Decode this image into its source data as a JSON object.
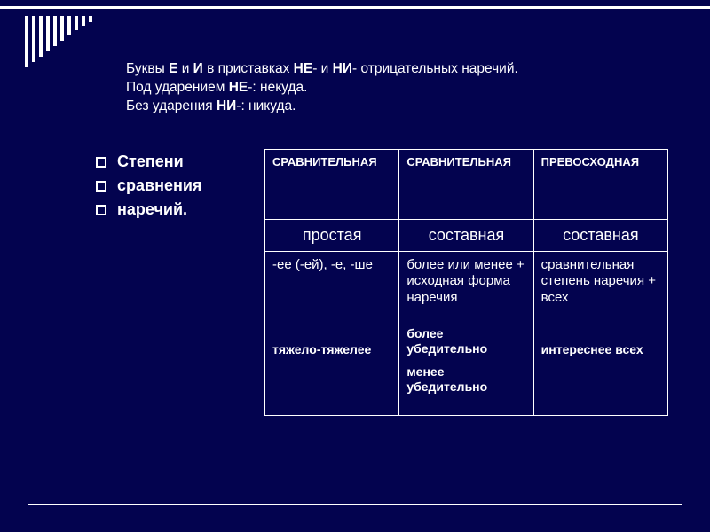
{
  "title": {
    "line1_a": "Буквы ",
    "line1_b": "Е",
    "line1_c": " и ",
    "line1_d": "И",
    "line1_e": " в приставках ",
    "line1_f": "НЕ",
    "line1_g": "- и ",
    "line1_h": "НИ",
    "line1_i": "- отрицательных наречий.",
    "line2_a": "Под ударением ",
    "line2_b": "НЕ",
    "line2_c": "-: некуда.",
    "line3_a": "Без ударения ",
    "line3_b": "НИ",
    "line3_c": "-: никуда."
  },
  "left_list": {
    "i0": "Степени",
    "i1": "сравнения",
    "i2": "наречий."
  },
  "table": {
    "head": {
      "c0": "СРАВНИТЕЛЬНАЯ",
      "c1": "СРАВНИТЕЛЬНАЯ",
      "c2": "ПРЕВОСХОДНАЯ"
    },
    "sub": {
      "c0": "простая",
      "c1": "составная",
      "c2": "составная"
    },
    "row": {
      "c0_rule": "-ее (-ей), -е, -ше",
      "c0_ex": "тяжело-тяжелее",
      "c1_rule": "более или менее + исходная форма наречия",
      "c1_ex1": "более убедительно",
      "c1_ex2": "менее убедительно",
      "c2_rule": "сравнительная степень наречия + всех",
      "c2_ex": "интереснее всех"
    }
  }
}
